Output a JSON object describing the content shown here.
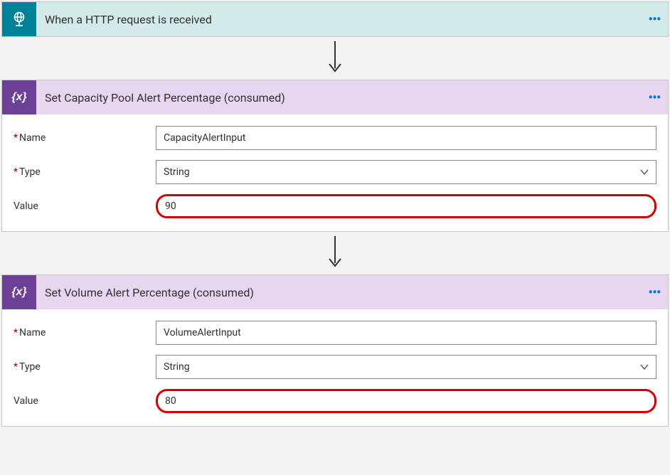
{
  "menuDots": "• • •",
  "trigger": {
    "title": "When a HTTP request is received"
  },
  "action1": {
    "title": "Set Capacity Pool Alert Percentage (consumed)",
    "fields": {
      "nameLabel": "Name",
      "nameValue": "CapacityAlertInput",
      "typeLabel": "Type",
      "typeValue": "String",
      "valueLabel": "Value",
      "valueValue": "90"
    }
  },
  "action2": {
    "title": "Set Volume Alert Percentage (consumed)",
    "fields": {
      "nameLabel": "Name",
      "nameValue": "VolumeAlertInput",
      "typeLabel": "Type",
      "typeValue": "String",
      "valueLabel": "Value",
      "valueValue": "80"
    }
  }
}
